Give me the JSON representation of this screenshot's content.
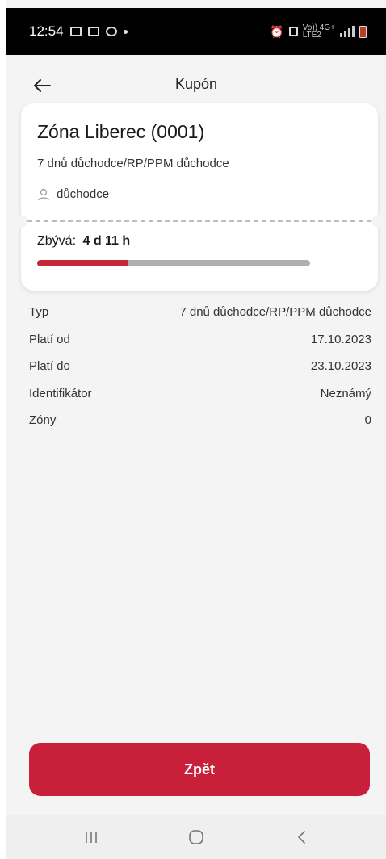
{
  "status_bar": {
    "time": "12:54",
    "indicators": [
      "notification-icon",
      "gallery-icon",
      "sync-icon",
      "dot-icon"
    ],
    "right_icons": [
      "alarm-icon",
      "lock-icon",
      "volte-icon",
      "4g-icon",
      "signal-icon",
      "battery-icon"
    ],
    "volte_label": "Vo)) 4G+",
    "lte_label": "LTE2",
    "battery_color": "#c0392b"
  },
  "header": {
    "title": "Kupón",
    "back_icon": "arrow-left-icon"
  },
  "card": {
    "zone_name": "Zóna Liberec (0001)",
    "coupon_type": "7 dnů důchodce/RP/PPM důchodce",
    "holder": "důchodce",
    "remaining_label": "Zbývá:",
    "remaining_value": "4 d 11 h",
    "progress_fraction": 0.33,
    "progress_color": "#c62838"
  },
  "details": [
    {
      "label": "Typ",
      "value": "7 dnů důchodce/RP/PPM důchodce"
    },
    {
      "label": "Platí od",
      "value": "17.10.2023"
    },
    {
      "label": "Platí do",
      "value": "23.10.2023"
    },
    {
      "label": "Identifikátor",
      "value": "Neznámý"
    },
    {
      "label": "Zóny",
      "value": "0"
    }
  ],
  "actions": {
    "back_label": "Zpět",
    "accent_color": "#c8203a"
  },
  "navbar": {
    "buttons": [
      "recent-apps-icon",
      "home-icon",
      "back-icon"
    ]
  }
}
